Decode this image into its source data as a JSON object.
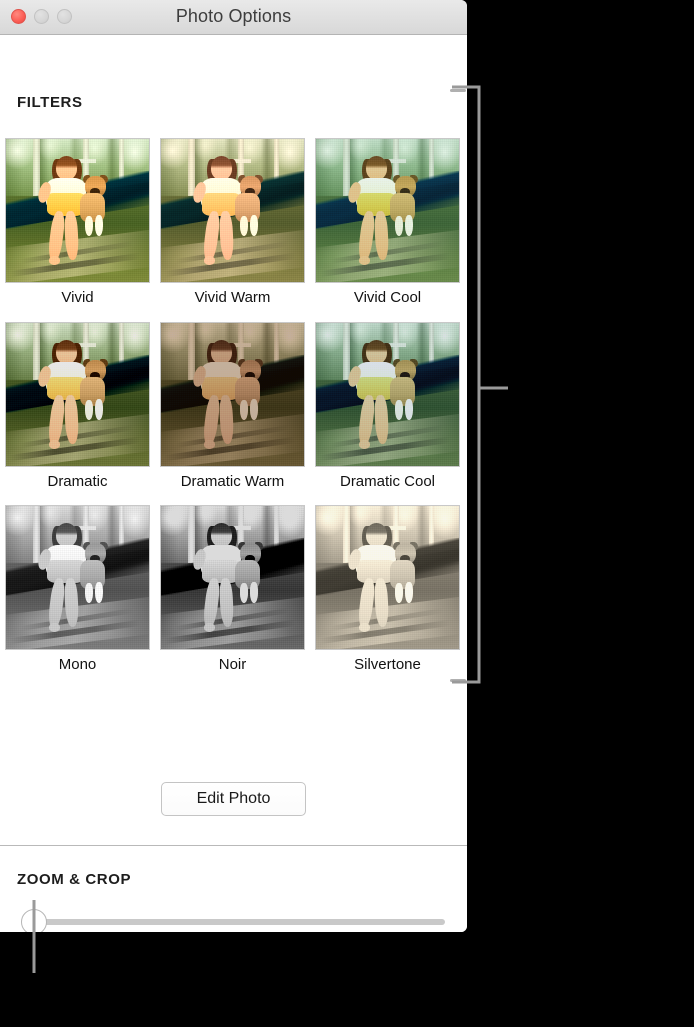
{
  "window": {
    "title": "Photo Options",
    "controls": {
      "close_label": "close",
      "minimize_label": "minimize",
      "maximize_label": "maximize"
    }
  },
  "filters_section": {
    "heading": "FILTERS",
    "items": [
      {
        "label": "Vivid",
        "effect": "fx-vivid"
      },
      {
        "label": "Vivid Warm",
        "effect": "fx-vivid-warm"
      },
      {
        "label": "Vivid Cool",
        "effect": "fx-vivid-cool"
      },
      {
        "label": "Dramatic",
        "effect": "fx-dramatic"
      },
      {
        "label": "Dramatic Warm",
        "effect": "fx-dramatic-warm"
      },
      {
        "label": "Dramatic Cool",
        "effect": "fx-dramatic-cool"
      },
      {
        "label": "Mono",
        "effect": "fx-mono"
      },
      {
        "label": "Noir",
        "effect": "fx-noir"
      },
      {
        "label": "Silvertone",
        "effect": "fx-silvertone"
      }
    ],
    "edit_photo_label": "Edit Photo"
  },
  "zoom_crop_section": {
    "heading": "ZOOM & CROP",
    "slider": {
      "value": 0,
      "min": 0,
      "max": 100
    }
  },
  "colors": {
    "window_background": "#ffffff",
    "titlebar_top": "#e9e9e9",
    "titlebar_bottom": "#d8d8d8",
    "close_button": "#fc6058",
    "inactive_button": "#d6d6d6",
    "title_text": "#3d3d3d",
    "heading_text": "#1d1d1d",
    "label_text": "#121212",
    "divider": "#b9b9b9",
    "slider_track": "#c9c9c9",
    "callout_line": "#9a9a9a",
    "page_background": "#000000"
  }
}
